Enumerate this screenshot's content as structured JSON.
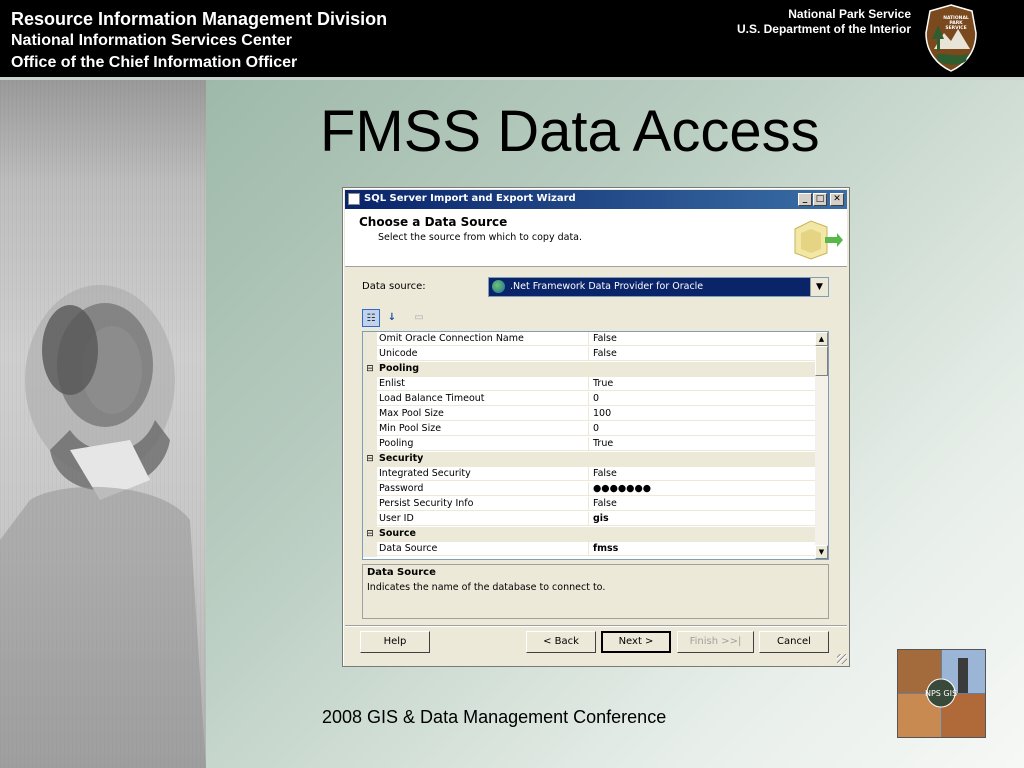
{
  "header": {
    "line1": "Resource Information Management Division",
    "line2": "National Information Services Center",
    "line3": "Office of the Chief Information Officer",
    "right1": "National Park Service",
    "right2": "U.S. Department of the Interior",
    "logo_text": [
      "NATIONAL",
      "PARK",
      "SERVICE"
    ]
  },
  "slide_title": "FMSS Data Access",
  "footer_text": "2008 GIS & Data Management Conference",
  "corner_logo_text": "NPS GIS",
  "dialog": {
    "window_title": "SQL Server Import and Export Wizard",
    "heading": "Choose a Data Source",
    "subheading": "Select the source from which to copy data.",
    "data_source_label": "Data source:",
    "data_source_value": ".Net Framework Data Provider for Oracle",
    "properties": [
      {
        "type": "prop",
        "name": "Omit Oracle Connection Name",
        "value": "False"
      },
      {
        "type": "prop",
        "name": "Unicode",
        "value": "False"
      },
      {
        "type": "cat",
        "name": "Pooling",
        "expander": "⊟"
      },
      {
        "type": "prop",
        "name": "Enlist",
        "value": "True"
      },
      {
        "type": "prop",
        "name": "Load Balance Timeout",
        "value": "0"
      },
      {
        "type": "prop",
        "name": "Max Pool Size",
        "value": "100"
      },
      {
        "type": "prop",
        "name": "Min Pool Size",
        "value": "0"
      },
      {
        "type": "prop",
        "name": "Pooling",
        "value": "True"
      },
      {
        "type": "cat",
        "name": "Security",
        "expander": "⊟"
      },
      {
        "type": "prop",
        "name": "Integrated Security",
        "value": "False"
      },
      {
        "type": "prop",
        "name": "Password",
        "value": "●●●●●●●",
        "bold": true
      },
      {
        "type": "prop",
        "name": "Persist Security Info",
        "value": "False"
      },
      {
        "type": "prop",
        "name": "User ID",
        "value": "gis",
        "bold": true
      },
      {
        "type": "cat",
        "name": "Source",
        "expander": "⊟"
      },
      {
        "type": "prop",
        "name": "Data Source",
        "value": "fmss",
        "bold": true
      }
    ],
    "description_title": "Data Source",
    "description_text": "Indicates the name of the database to connect to.",
    "buttons": {
      "help": "Help",
      "back": "< Back",
      "next": "Next >",
      "finish": "Finish >>|",
      "cancel": "Cancel"
    },
    "window_buttons": {
      "minimize": "_",
      "maximize": "□",
      "close": "✕"
    }
  }
}
